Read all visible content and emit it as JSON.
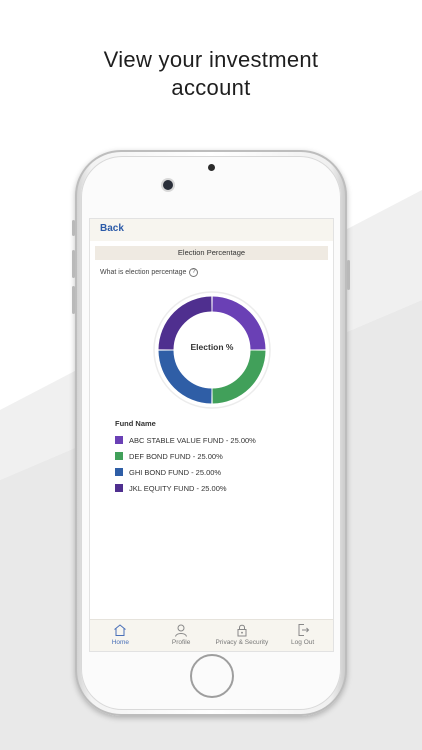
{
  "headline": {
    "line1": "View your investment",
    "line2": "account"
  },
  "screen": {
    "back_label": "Back",
    "section_title": "Election Percentage",
    "question": "What is election percentage",
    "help_icon_glyph": "?",
    "donut_center_label": "Election %",
    "legend_title": "Fund Name"
  },
  "chart_data": {
    "type": "pie",
    "slices": [
      {
        "label": "ABC STABLE VALUE FUND - 25.00%",
        "value": 25.0,
        "color": "#6a40b5"
      },
      {
        "label": "DEF BOND FUND - 25.00%",
        "value": 25.0,
        "color": "#41a05a"
      },
      {
        "label": "GHI BOND FUND - 25.00%",
        "value": 25.0,
        "color": "#2f5ea6"
      },
      {
        "label": "JKL EQUITY FUND - 25.00%",
        "value": 25.0,
        "color": "#4f2f8f"
      }
    ]
  },
  "tabs": [
    {
      "label": "Home",
      "icon": "home-icon",
      "active": true
    },
    {
      "label": "Profile",
      "icon": "user-icon",
      "active": false
    },
    {
      "label": "Privacy & Security",
      "icon": "lock-icon",
      "active": false
    },
    {
      "label": "Log Out",
      "icon": "logout-icon",
      "active": false
    }
  ],
  "colors": {
    "accent": "#2b5aa8",
    "tab_active": "#4a70b8",
    "nav_bg": "#f7f5ef"
  }
}
